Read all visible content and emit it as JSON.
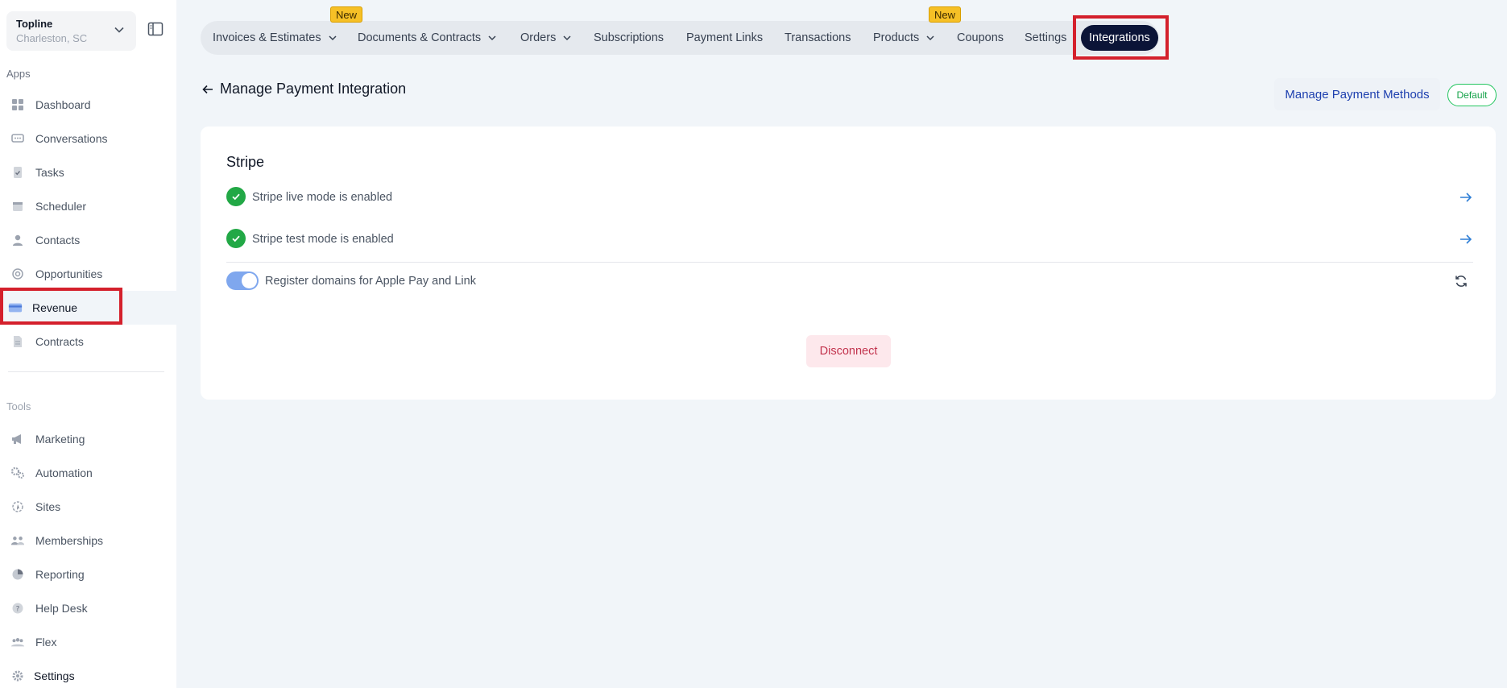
{
  "account": {
    "name": "Topline",
    "location": "Charleston, SC"
  },
  "sidebar": {
    "apps_label": "Apps",
    "tools_label": "Tools",
    "apps": [
      {
        "label": "Dashboard",
        "icon": "dashboard-icon"
      },
      {
        "label": "Conversations",
        "icon": "chat-icon"
      },
      {
        "label": "Tasks",
        "icon": "tasks-icon"
      },
      {
        "label": "Scheduler",
        "icon": "calendar-icon"
      },
      {
        "label": "Contacts",
        "icon": "person-icon"
      },
      {
        "label": "Opportunities",
        "icon": "target-icon"
      },
      {
        "label": "Revenue",
        "icon": "credit-card-icon"
      },
      {
        "label": "Contracts",
        "icon": "document-icon"
      }
    ],
    "tools": [
      {
        "label": "Marketing",
        "icon": "megaphone-icon"
      },
      {
        "label": "Automation",
        "icon": "gears-icon"
      },
      {
        "label": "Sites",
        "icon": "sites-icon"
      },
      {
        "label": "Memberships",
        "icon": "group-icon"
      },
      {
        "label": "Reporting",
        "icon": "pie-chart-icon"
      },
      {
        "label": "Help Desk",
        "icon": "help-icon"
      },
      {
        "label": "Flex",
        "icon": "team-icon"
      },
      {
        "label": "Settings",
        "icon": "gear-icon"
      }
    ]
  },
  "topnav": {
    "tabs": [
      {
        "label": "Invoices & Estimates"
      },
      {
        "label": "Documents & Contracts"
      },
      {
        "label": "Orders"
      },
      {
        "label": "Subscriptions"
      },
      {
        "label": "Payment Links"
      },
      {
        "label": "Transactions"
      },
      {
        "label": "Products"
      },
      {
        "label": "Coupons"
      },
      {
        "label": "Settings"
      },
      {
        "label": "Integrations"
      }
    ],
    "new_badge": "New"
  },
  "header": {
    "title": "Manage Payment Integration",
    "manage_methods": "Manage Payment Methods",
    "default_badge": "Default"
  },
  "card": {
    "title": "Stripe",
    "live_mode": "Stripe live mode is enabled",
    "test_mode": "Stripe test mode is enabled",
    "apple_pay": "Register domains for Apple Pay and Link",
    "apple_pay_enabled": true,
    "disconnect": "Disconnect"
  },
  "colors": {
    "accent": "#0b1437",
    "success": "#22a846",
    "danger": "#c2334d",
    "highlight": "#d4202c"
  }
}
